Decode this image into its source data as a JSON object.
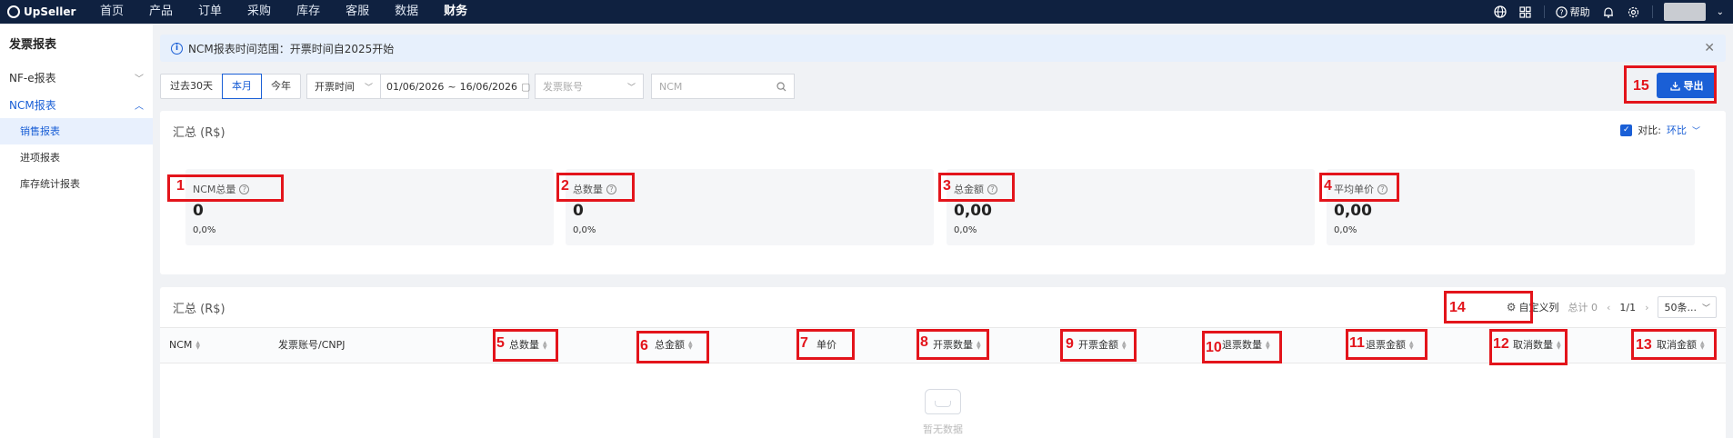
{
  "topbar": {
    "brand": "UpSeller",
    "nav": [
      "首页",
      "产品",
      "订单",
      "采购",
      "库存",
      "客服",
      "数据",
      "财务"
    ],
    "active_nav": "财务",
    "help_label": "帮助"
  },
  "sidebar": {
    "title": "发票报表",
    "groups": [
      {
        "label": "NF-e报表",
        "open": false
      },
      {
        "label": "NCM报表",
        "open": true
      }
    ],
    "sub_items": [
      "销售报表",
      "进项报表",
      "库存统计报表"
    ],
    "active_sub": "销售报表"
  },
  "notice": {
    "text": "NCM报表时间范围：开票时间自2025开始"
  },
  "filters": {
    "range_buttons": [
      "过去30天",
      "本月",
      "今年"
    ],
    "active_range": "本月",
    "time_type": "开票时间",
    "date_start": "01/06/2026",
    "date_sep": "~",
    "date_end": "16/06/2026",
    "account_placeholder": "发票账号",
    "ncm_placeholder": "NCM",
    "export_label": "导出"
  },
  "summary": {
    "title": "汇总 (R$)",
    "compare_label": "对比:",
    "compare_value": "环比",
    "stats": [
      {
        "label": "NCM总量",
        "value": "0",
        "pct": "0,0%"
      },
      {
        "label": "总数量",
        "value": "0",
        "pct": "0,0%"
      },
      {
        "label": "总金额",
        "value": "0,00",
        "pct": "0,0%"
      },
      {
        "label": "平均单价",
        "value": "0,00",
        "pct": "0,0%"
      }
    ]
  },
  "table": {
    "title": "汇总 (R$)",
    "custom_columns_label": "自定义列",
    "total_label": "总计 0",
    "page": "1/1",
    "page_size": "50条...",
    "columns": [
      "NCM",
      "发票账号/CNPJ",
      "总数量",
      "总金额",
      "单价",
      "开票数量",
      "开票金额",
      "退票数量",
      "退票金额",
      "取消数量",
      "取消金额"
    ],
    "empty_text": "暂无数据"
  },
  "annotations": [
    "1",
    "2",
    "3",
    "4",
    "5",
    "6",
    "7",
    "8",
    "9",
    "10",
    "11",
    "12",
    "13",
    "14",
    "15"
  ],
  "colors": {
    "brand_navy": "#0f2140",
    "primary": "#1a5fd6",
    "annotation_red": "#e3141b"
  }
}
